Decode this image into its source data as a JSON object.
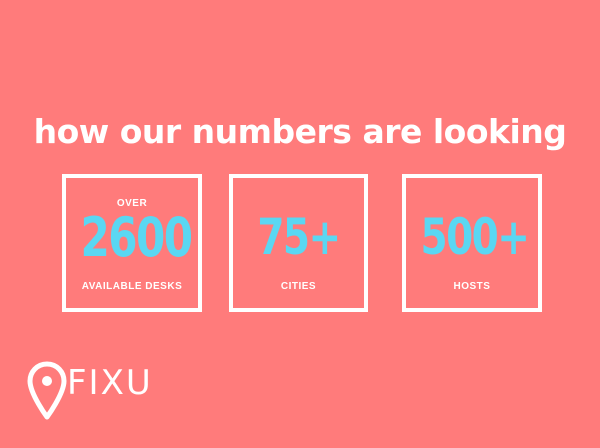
{
  "headline": "how our numbers are looking",
  "stats": [
    {
      "prefix": "OVER",
      "value": "2600",
      "label": "AVAILABLE DESKS"
    },
    {
      "prefix": "",
      "value": "75+",
      "label": "CITIES"
    },
    {
      "prefix": "",
      "value": "500+",
      "label": "HOSTS"
    }
  ],
  "logo": {
    "text": "FIXU",
    "icon": "map-pin-icon"
  },
  "colors": {
    "background": "#ff7b7b",
    "accent": "#5ad7f2",
    "text": "#ffffff"
  }
}
